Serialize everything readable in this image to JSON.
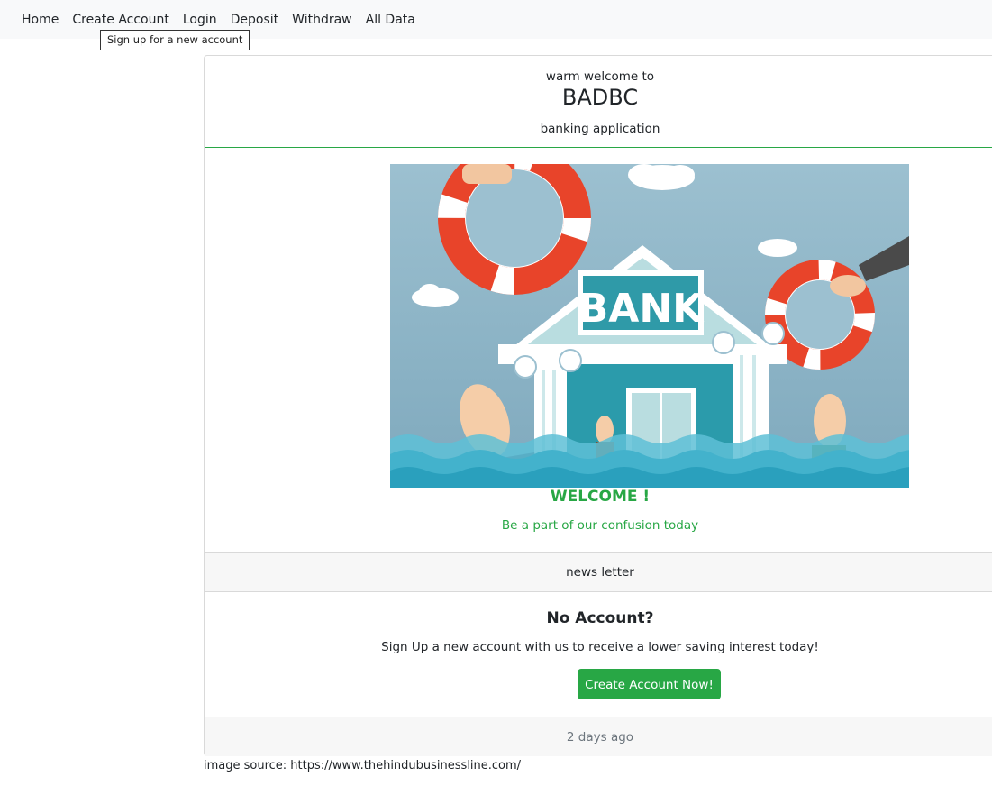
{
  "nav": {
    "items": [
      "Home",
      "Create Account",
      "Login",
      "Deposit",
      "Withdraw",
      "All Data"
    ]
  },
  "tooltip": "Sign up for a new account",
  "card": {
    "header_pre": "warm welcome to",
    "title": "BADBC",
    "subtitle": "banking application",
    "hero_sign": "BANK",
    "welcome": "WELCOME !",
    "tagline": "Be a part of our confusion today",
    "newsletter": "news letter",
    "section_title": "No Account?",
    "section_text": "Sign Up a new account with us to receive a lower saving interest today!",
    "cta": "Create Account Now!",
    "footer": "2 days ago"
  },
  "image_source": "image source: https://www.thehindubusinessline.com/",
  "colors": {
    "accent": "#28a745",
    "navbar_bg": "#f8f9fa",
    "sky": "#8fb4c6",
    "bank": "#3aa7b3"
  }
}
